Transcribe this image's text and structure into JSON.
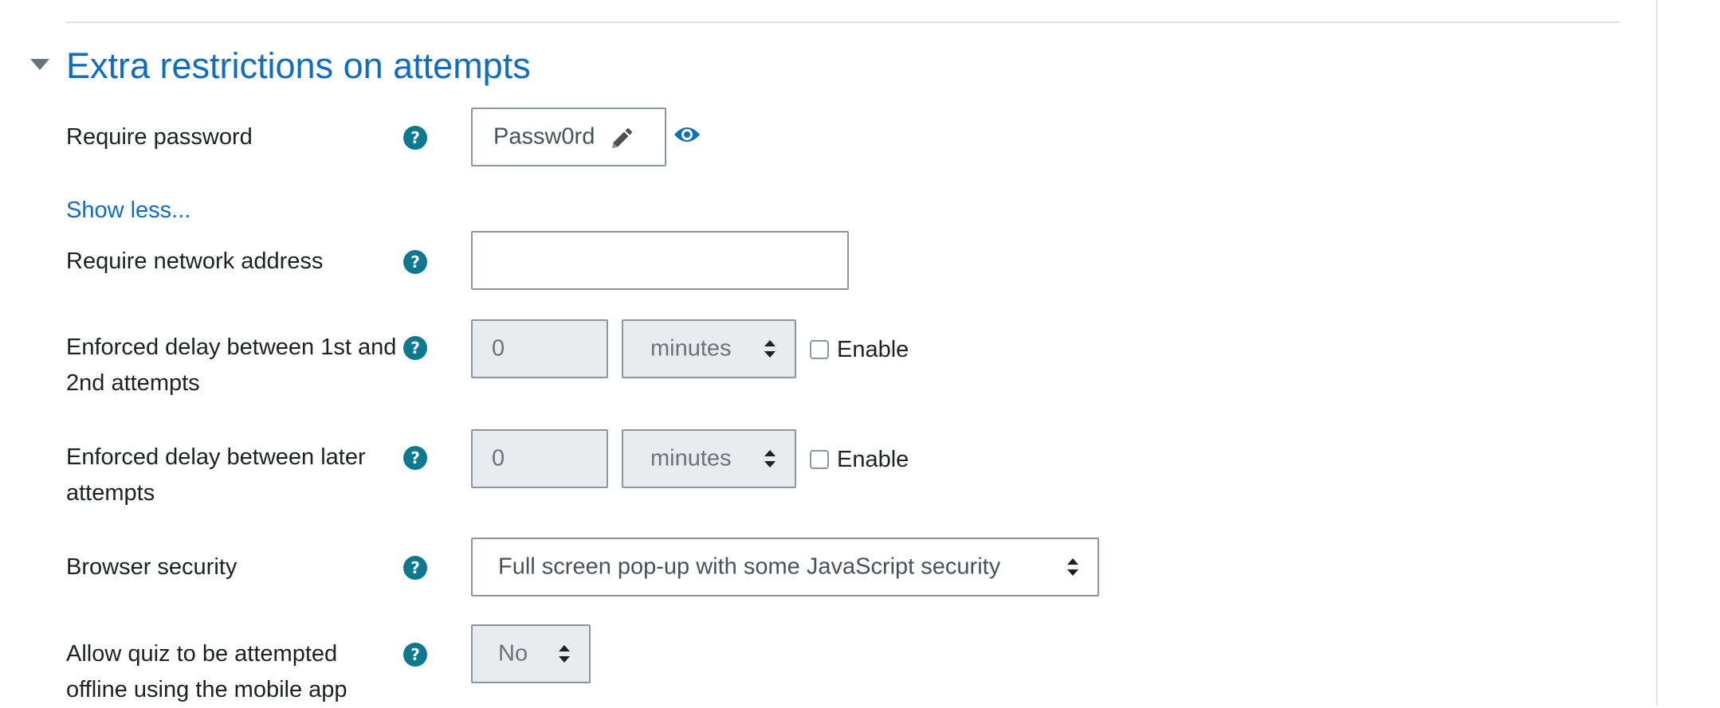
{
  "section": {
    "title": "Extra restrictions on attempts"
  },
  "require_password": {
    "label": "Require password",
    "value": "Passw0rd"
  },
  "show_less_link": "Show less...",
  "network_address": {
    "label": "Require network address",
    "value": ""
  },
  "delay_first_second": {
    "label": "Enforced delay between 1st and 2nd attempts",
    "value": "0",
    "unit": "minutes",
    "enable_label": "Enable",
    "enabled": false
  },
  "delay_later": {
    "label": "Enforced delay between later attempts",
    "value": "0",
    "unit": "minutes",
    "enable_label": "Enable",
    "enabled": false
  },
  "browser_security": {
    "label": "Browser security",
    "selected": "Full screen pop-up with some JavaScript security"
  },
  "offline_attempts": {
    "label": "Allow quiz to be attempted offline using the mobile app",
    "selected": "No"
  },
  "help_icon_glyph": "?",
  "colors": {
    "link": "#0f6cbf",
    "help_icon": "#0f7891",
    "text": "#1d2125",
    "disabled_bg": "#e9ecef"
  }
}
